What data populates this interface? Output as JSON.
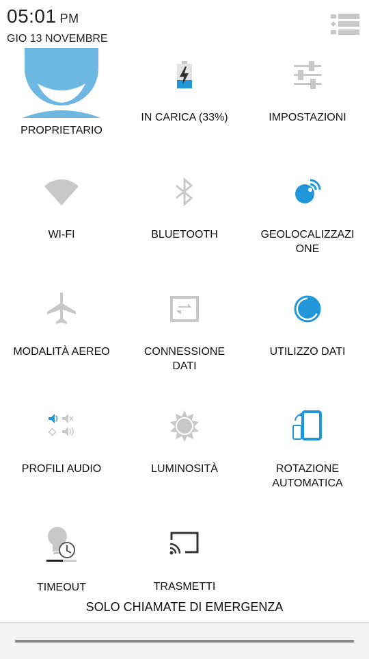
{
  "status": {
    "time": "05:01",
    "ampm": "PM",
    "date": "GIO 13 NOVEMBRE"
  },
  "tiles": [
    {
      "label": "PROPRIETARIO",
      "icon": "user-avatar-icon"
    },
    {
      "label": "IN CARICA (33%)",
      "icon": "battery-charging-icon"
    },
    {
      "label": "IMPOSTAZIONI",
      "icon": "settings-sliders-icon"
    },
    {
      "label": "WI-FI",
      "icon": "wifi-icon"
    },
    {
      "label": "BLUETOOTH",
      "icon": "bluetooth-icon"
    },
    {
      "label": "GEOLOCALIZZAZI",
      "label2": "ONE",
      "icon": "location-icon"
    },
    {
      "label": "MODALITÀ AEREO",
      "icon": "airplane-icon"
    },
    {
      "label": "CONNESSIONE",
      "label2": "DATI",
      "icon": "data-connection-icon"
    },
    {
      "label": "UTILIZZO DATI",
      "icon": "data-usage-icon"
    },
    {
      "label": "PROFILI AUDIO",
      "icon": "audio-profiles-icon"
    },
    {
      "label": "LUMINOSITÀ",
      "icon": "brightness-icon"
    },
    {
      "label": "ROTAZIONE",
      "label2": "AUTOMATICA",
      "icon": "auto-rotate-icon"
    },
    {
      "label": "TIMEOUT",
      "icon": "timeout-icon"
    },
    {
      "label": "TRASMETTI",
      "icon": "cast-icon"
    }
  ],
  "footer": {
    "emergency": "SOLO CHIAMATE DI EMERGENZA"
  },
  "colors": {
    "accent": "#2196d8",
    "avatar": "#6cb8e3",
    "inactive": "#c8c8c8"
  }
}
